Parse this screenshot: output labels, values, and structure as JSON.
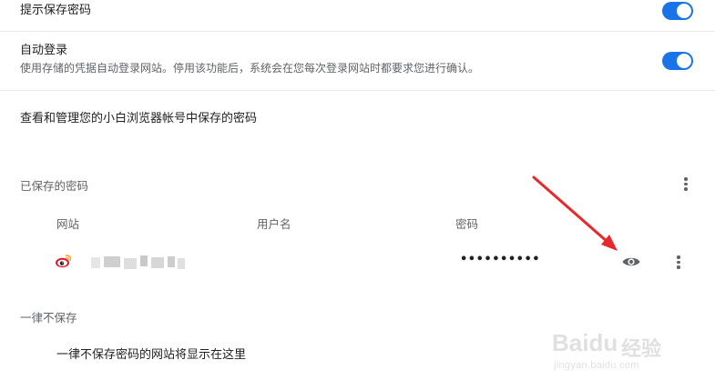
{
  "settings": {
    "offer_to_save": {
      "label": "提示保存密码",
      "enabled": true
    },
    "auto_signin": {
      "label": "自动登录",
      "description": "使用存储的凭据自动登录网站。停用该功能后，系统会在您每次登录网站时都要求您进行确认。",
      "enabled": true
    },
    "manage_text": "查看和管理您的小白浏览器帐号中保存的密码"
  },
  "saved_passwords": {
    "heading": "已保存的密码",
    "columns": [
      "网站",
      "用户名",
      "密码"
    ],
    "rows": [
      {
        "site_icon": "weibo-icon",
        "site": "",
        "username": "",
        "password": "••••••••••"
      }
    ]
  },
  "never_saved": {
    "heading": "一律不保存",
    "empty_text": "一律不保存密码的网站将显示在这里"
  },
  "icons": {
    "more_menu": "more-vert-icon",
    "show_password": "eye-icon",
    "annotation": "red-arrow"
  },
  "colors": {
    "toggle_on": "#1a73e8",
    "arrow": "#e8282d",
    "weibo_red": "#e6162d",
    "weibo_yellow": "#f5a623",
    "divider": "#e8eaed"
  },
  "watermark": {
    "brand": "Bai",
    "brand_suffix": "du",
    "cn": "经验",
    "url": "jingyan.baidu.com"
  }
}
